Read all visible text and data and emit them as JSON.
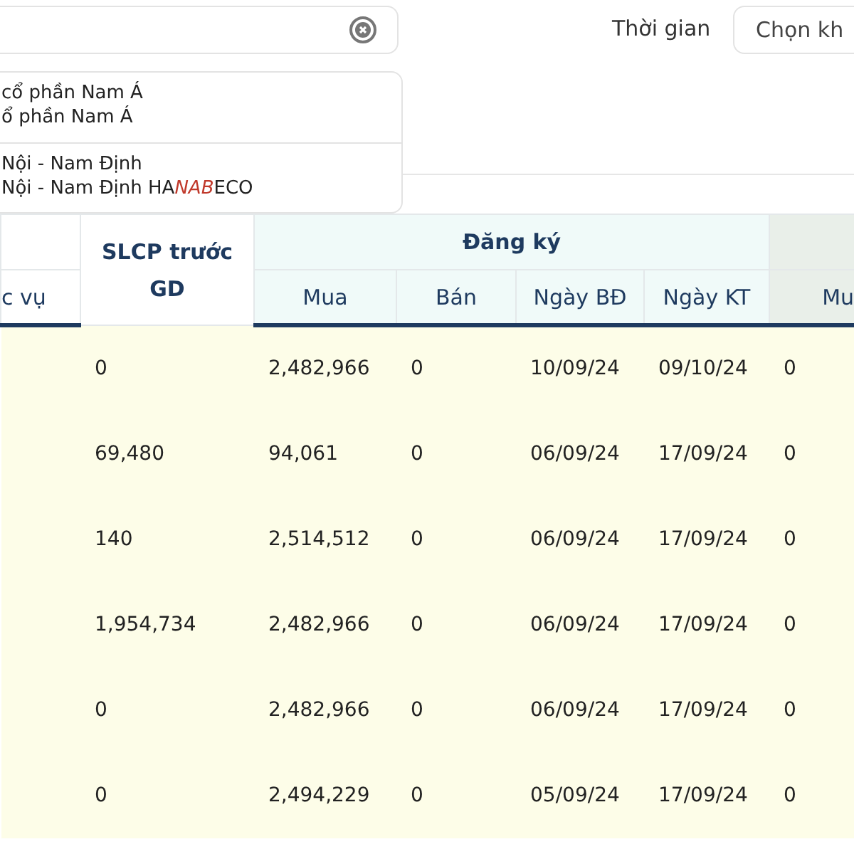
{
  "time_filter": {
    "label": "Thời gian",
    "button": "Chọn kh"
  },
  "dropdown": [
    {
      "lines": [
        "cổ phần Nam Á",
        "ổ phần Nam Á"
      ]
    },
    {
      "lines": [
        "Nội - Nam Định",
        [
          {
            "text": "Nội - Nam Định HA",
            "kind": "plain"
          },
          {
            "text": "NAB",
            "kind": "highlight"
          },
          {
            "text": "ECO",
            "kind": "plain"
          }
        ]
      ]
    }
  ],
  "table": {
    "col_0": "c vụ",
    "col_1": "SLCP trước GD",
    "group_1": "Đăng ký",
    "group_1_columns": [
      "Mua",
      "Bán",
      "Ngày BĐ",
      "Ngày KT"
    ],
    "group_2_columns": [
      "Mu"
    ],
    "rows": [
      [
        "0",
        "2,482,966",
        "0",
        "10/09/24",
        "09/10/24",
        "0"
      ],
      [
        "69,480",
        "94,061",
        "0",
        "06/09/24",
        "17/09/24",
        "0"
      ],
      [
        "140",
        "2,514,512",
        "0",
        "06/09/24",
        "17/09/24",
        "0"
      ],
      [
        "1,954,734",
        "2,482,966",
        "0",
        "06/09/24",
        "17/09/24",
        "0"
      ],
      [
        "0",
        "2,482,966",
        "0",
        "06/09/24",
        "17/09/24",
        "0"
      ],
      [
        "0",
        "2,494,229",
        "0",
        "05/09/24",
        "17/09/24",
        "0"
      ]
    ]
  }
}
